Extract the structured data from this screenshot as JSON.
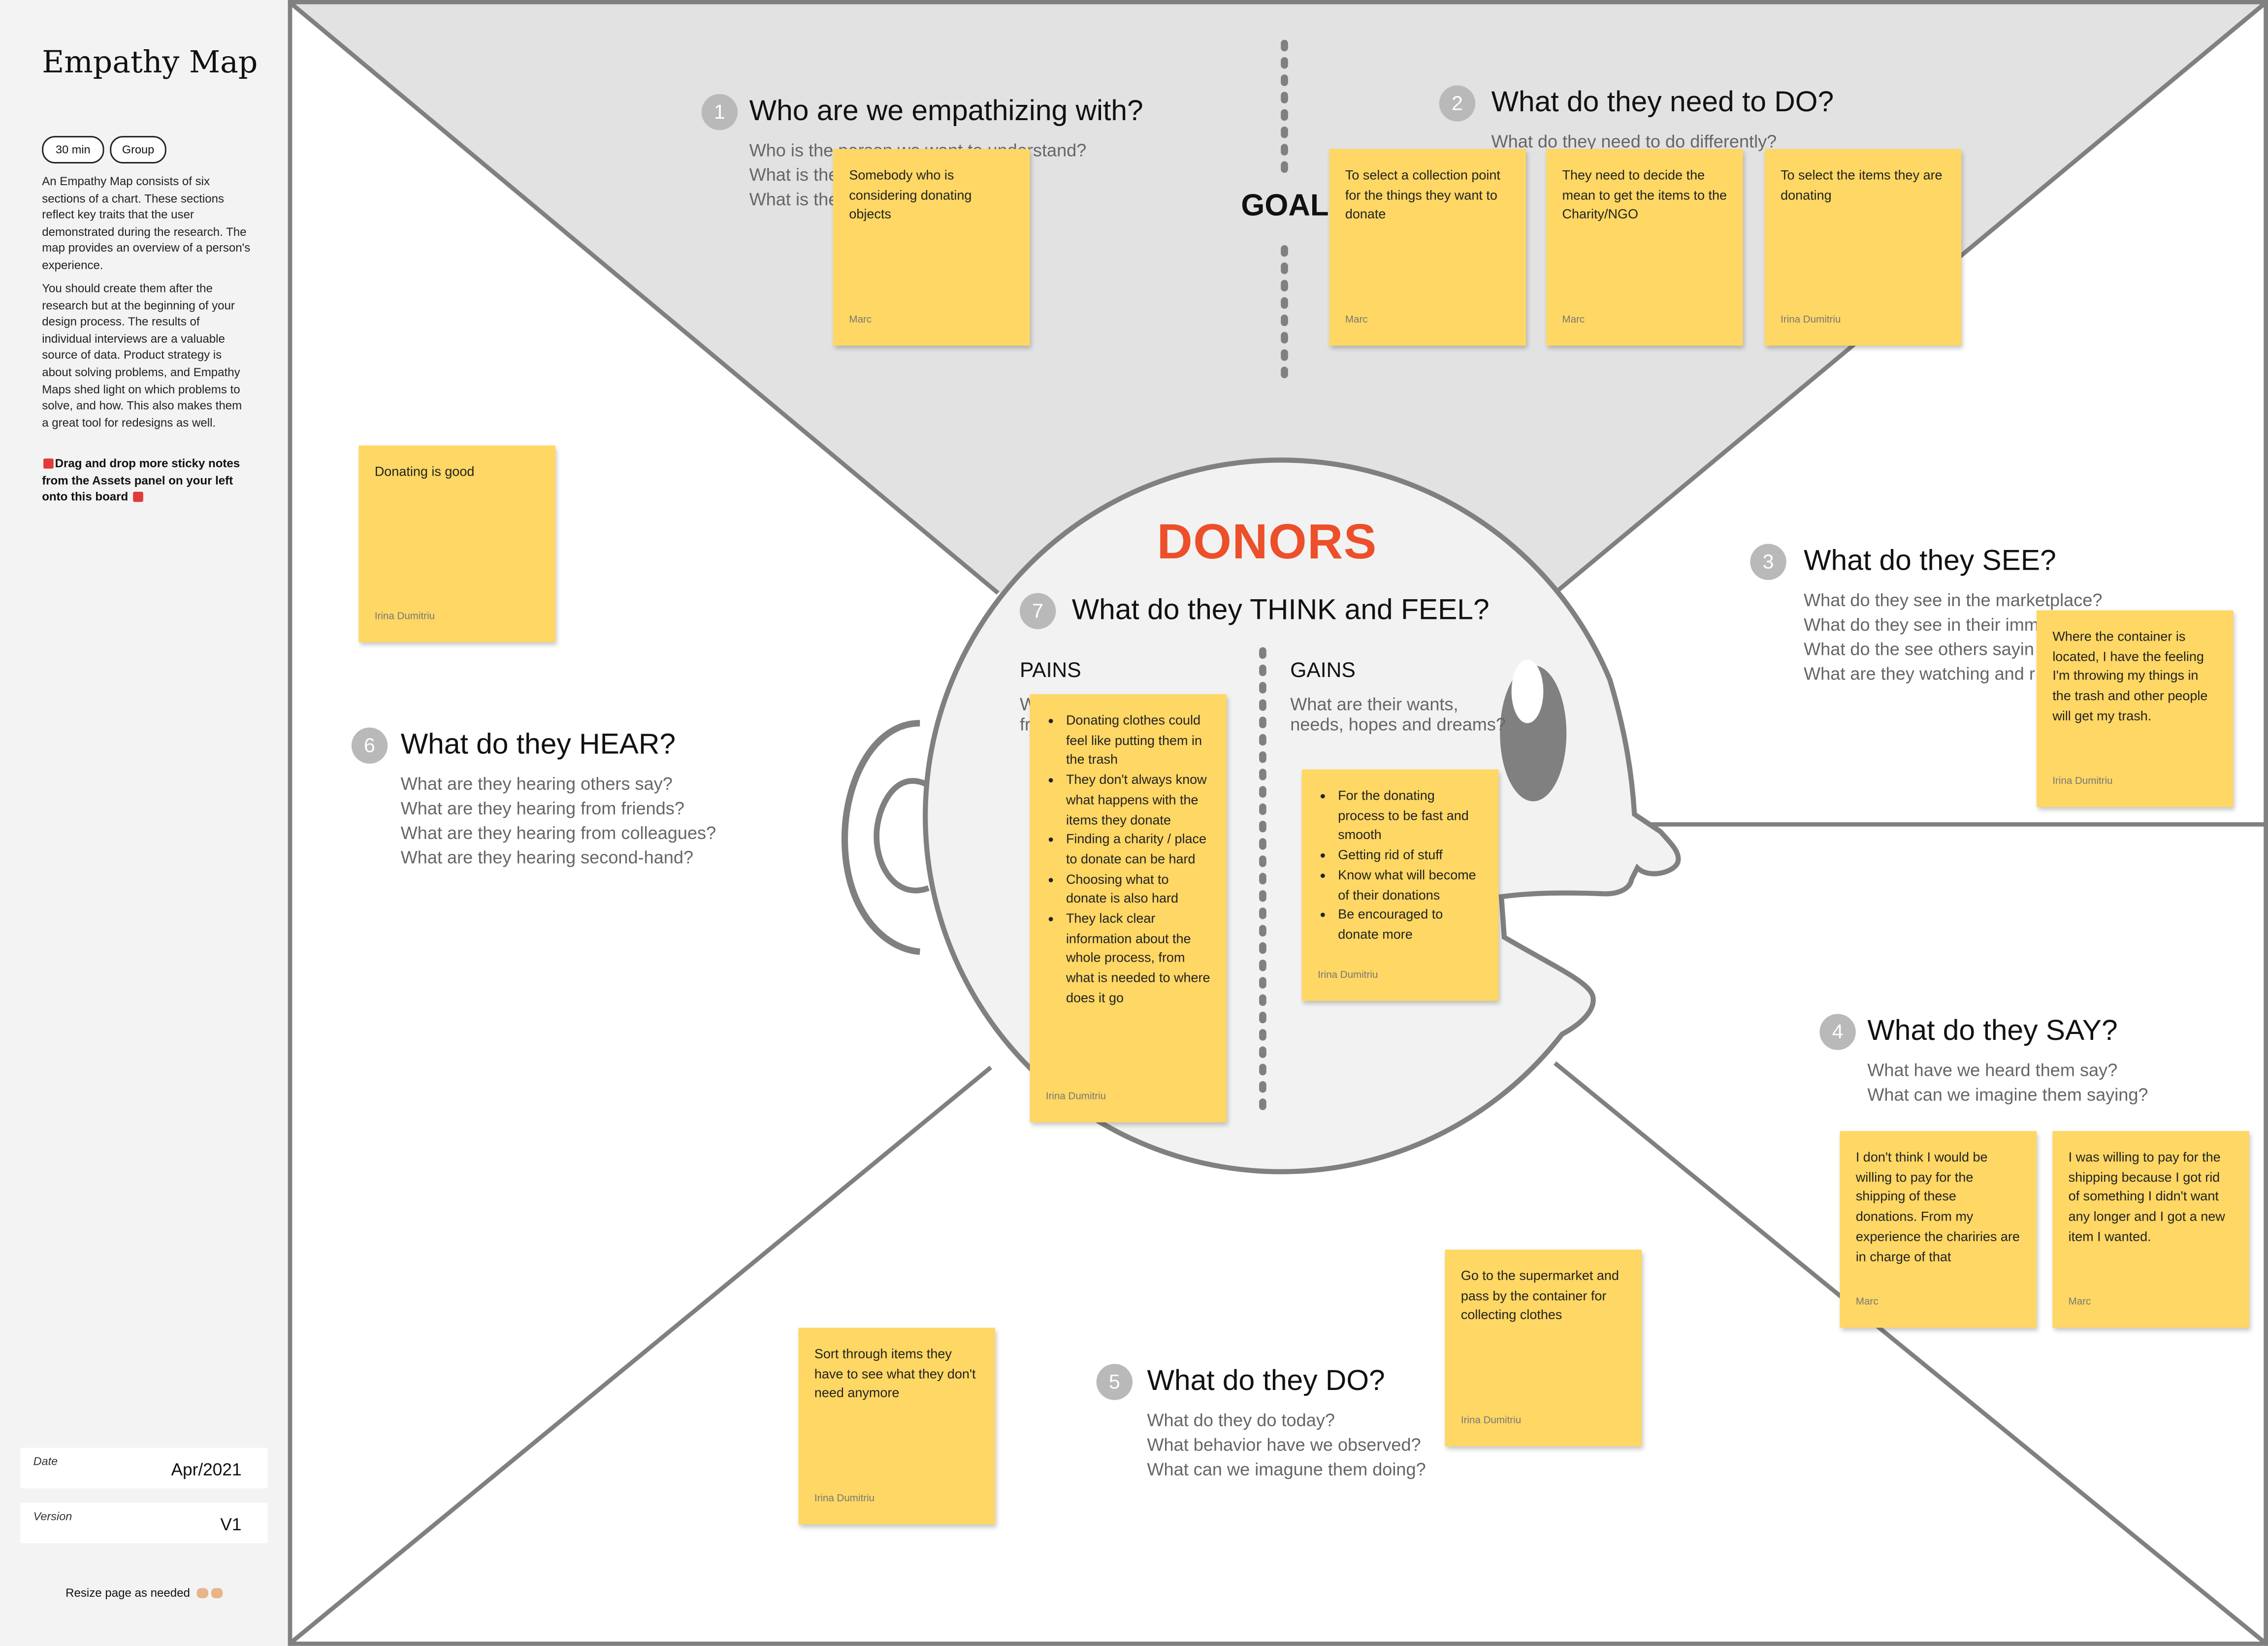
{
  "sidebar": {
    "title": "Empathy Map",
    "tags": [
      "30 min",
      "Group"
    ],
    "description_1": "An Empathy Map consists of six sections of a chart. These sections reflect key traits that the user demonstrated during the research. The map provides an overview of a person's experience.",
    "description_2": "You should create them after the research but at the beginning of your design process. The results of individual interviews are a valuable source of data. Product strategy is about solving problems, and Empathy Maps shed light on which problems to solve, and how. This also makes them a great tool for redesigns as well.",
    "instruction": "Drag and drop more sticky notes from the Assets panel on your left onto this board",
    "date_label": "Date",
    "date_value": "Apr/2021",
    "version_label": "Version",
    "version_value": "V1",
    "resize_note": "Resize page as needed"
  },
  "board": {
    "persona": "DONORS",
    "goal_label": "GOAL",
    "pains": {
      "title": "PAINS",
      "subtitle_fragment": "W fr"
    },
    "gains": {
      "title": "GAINS",
      "subtitle": "What are their wants, needs, hopes and dreams?"
    }
  },
  "sections": {
    "s1": {
      "number": "1",
      "title": "Who are we empathizing with?",
      "lines": [
        "Who is the person we want to understand?",
        "What is the",
        "What is the"
      ]
    },
    "s2": {
      "number": "2",
      "title": "What do they need to DO?",
      "lines": [
        "What do they need to do differently?"
      ]
    },
    "s3": {
      "number": "3",
      "title": "What do they SEE?",
      "lines": [
        "What do they see in the marketplace?",
        "What do they see in their imm",
        "What do the see others sayin",
        "What are they watching and r"
      ]
    },
    "s4": {
      "number": "4",
      "title": "What do they SAY?",
      "lines": [
        "What have we heard them say?",
        "What can we imagine them saying?"
      ]
    },
    "s5": {
      "number": "5",
      "title": "What do they DO?",
      "lines": [
        "What do they do today?",
        "What behavior have we observed?",
        "What can we imagune them doing?"
      ]
    },
    "s6": {
      "number": "6",
      "title": "What do they HEAR?",
      "lines": [
        "What are they hearing others say?",
        "What are they hearing from friends?",
        "What are they hearing from colleagues?",
        "What are they hearing second-hand?"
      ]
    },
    "s7": {
      "number": "7",
      "title": "What do they THINK and FEEL?"
    }
  },
  "stickies": {
    "n1": {
      "text": "Somebody who is considering donating objects",
      "author": "Marc"
    },
    "n2": {
      "text": "To select a collection point for the things they want to donate",
      "author": "Marc"
    },
    "n3": {
      "text": "They need to decide the mean to get the items to the Charity/NGO",
      "author": "Marc"
    },
    "n4": {
      "text": "To select the items they are donating",
      "author": "Irina Dumitriu"
    },
    "n5": {
      "text": "Donating is good",
      "author": "Irina Dumitriu"
    },
    "n6": {
      "text": "Where the container is located, I have the feeling I'm throwing my things in the trash and other people will get my trash.",
      "author": "Irina Dumitriu"
    },
    "n7": {
      "items": [
        "Donating clothes could feel like putting them in the trash",
        "They don't always know what happens with the items they donate",
        "Finding a charity / place to donate can be hard",
        "Choosing what to donate is also hard",
        "They lack clear information about the whole process, from what is needed to where does it go"
      ],
      "author": "Irina Dumitriu"
    },
    "n8": {
      "items": [
        "For the donating process to be fast and smooth",
        "Getting rid of stuff",
        "Know what will become of their donations",
        "Be encouraged to donate more"
      ],
      "author": "Irina Dumitriu"
    },
    "n9": {
      "text": "I don't think I would be willing to pay for the shipping of these donations. From my experience the chariries are in charge of that",
      "author": "Marc"
    },
    "n10": {
      "text": "I was willing to pay for the shipping because I got rid of something I didn't want any longer and I got a new item I wanted.",
      "author": "Marc"
    },
    "n11": {
      "text": "Go to the supermarket and pass by the container for collecting clothes",
      "author": "Irina Dumitriu"
    },
    "n12": {
      "text": "Sort through items they have to see what they don't need anymore",
      "author": "Irina Dumitriu"
    }
  },
  "colors": {
    "sticky": "#fed764",
    "accent": "#ec4f2a",
    "line": "#808080",
    "top_fill": "#e2e2e2",
    "head_fill": "#f2f2f2"
  }
}
